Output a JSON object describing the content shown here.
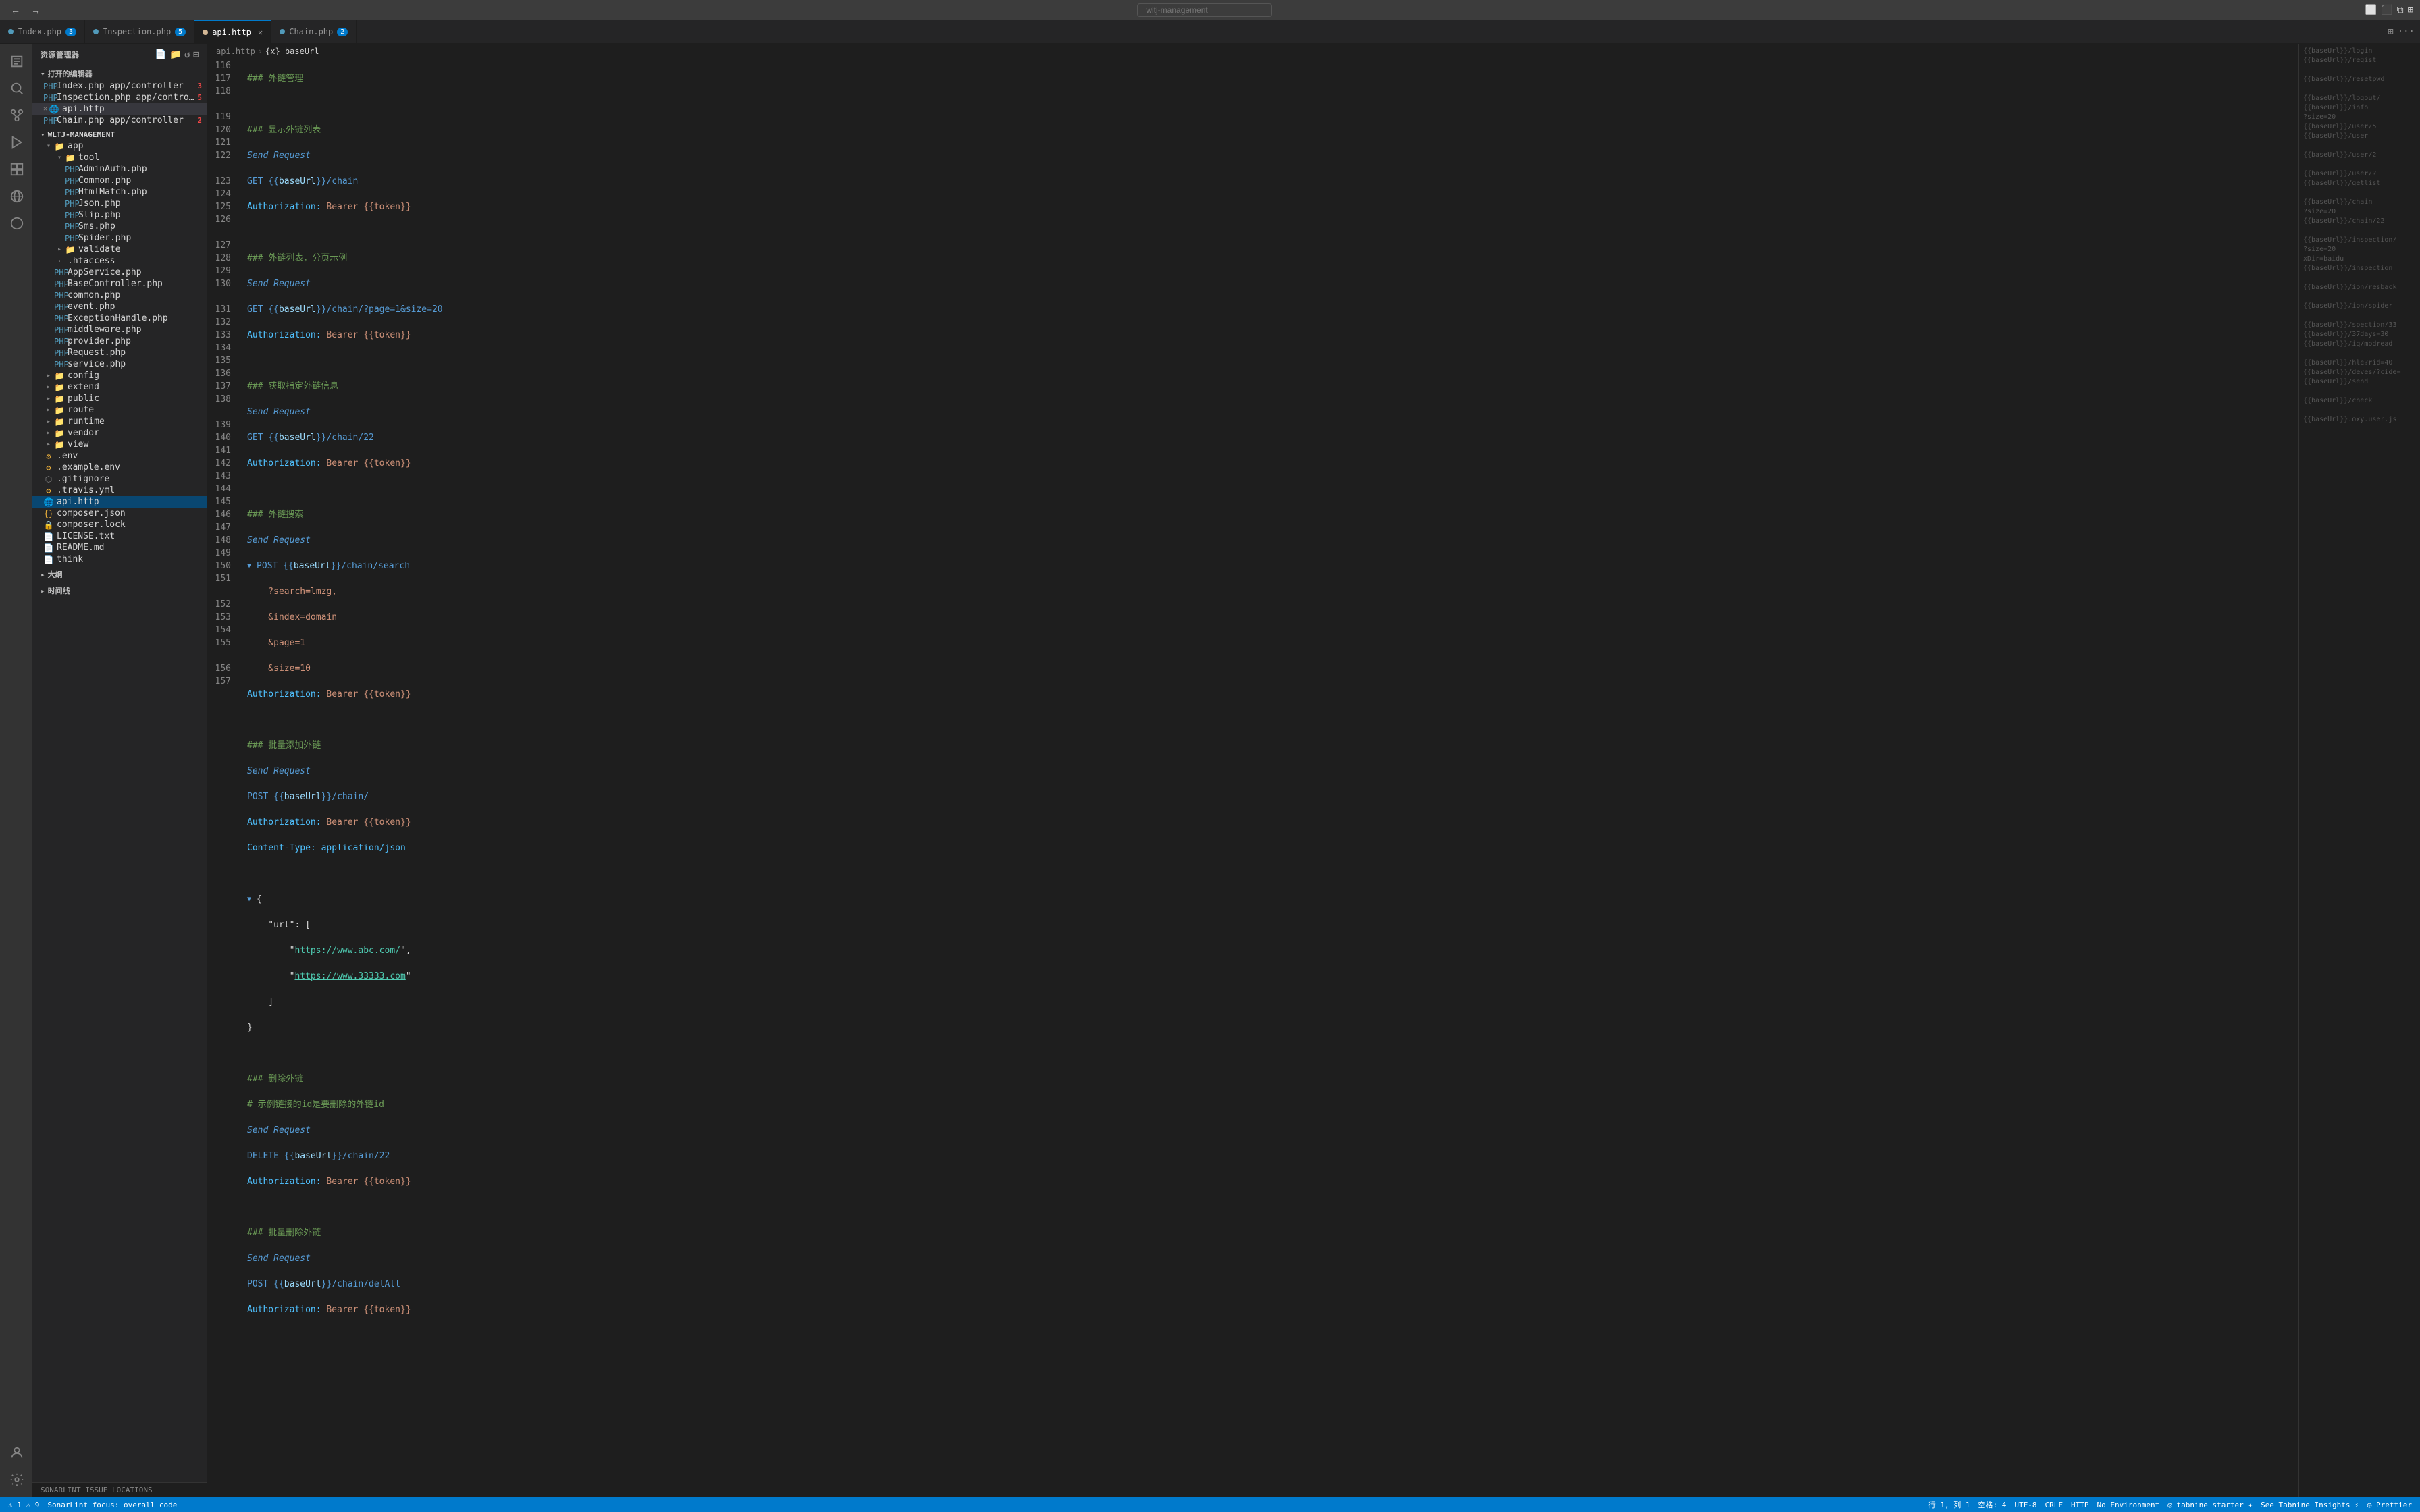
{
  "titleBar": {
    "back": "←",
    "forward": "→",
    "searchPlaceholder": "witj-management",
    "layoutIcons": [
      "⬜",
      "⬛",
      "⧉",
      "⊞"
    ]
  },
  "tabs": [
    {
      "id": "index",
      "icon": "php",
      "iconColor": "#519aba",
      "label": "Index.php",
      "badge": "3",
      "active": false,
      "modified": false
    },
    {
      "id": "inspection",
      "icon": "php",
      "iconColor": "#519aba",
      "label": "Inspection.php",
      "badge": "5",
      "active": false,
      "modified": false
    },
    {
      "id": "api",
      "icon": "http",
      "iconColor": "#d4b896",
      "label": "api.http",
      "active": true,
      "modified": false,
      "close": true
    },
    {
      "id": "chain",
      "icon": "php",
      "iconColor": "#519aba",
      "label": "Chain.php",
      "badge": "2",
      "active": false,
      "modified": false
    }
  ],
  "activityBar": {
    "items": [
      {
        "id": "explorer",
        "icon": "📄",
        "active": false
      },
      {
        "id": "search",
        "icon": "🔍",
        "active": false
      },
      {
        "id": "scm",
        "icon": "⑂",
        "active": false
      },
      {
        "id": "debug",
        "icon": "▶",
        "active": false
      },
      {
        "id": "extensions",
        "icon": "⊞",
        "active": false
      },
      {
        "id": "remote",
        "icon": "☁",
        "active": false
      },
      {
        "id": "accounts",
        "icon": "👤",
        "active": false
      },
      {
        "id": "settings",
        "icon": "⚙",
        "active": false
      }
    ]
  },
  "sidebar": {
    "explorerTitle": "资源管理器",
    "openEditorsTitle": "打开的编辑器",
    "openFiles": [
      {
        "name": "Index.php",
        "path": "app/controller",
        "badge": "3",
        "icon": "php",
        "iconColor": "#519aba"
      },
      {
        "name": "Inspection.php",
        "path": "app/controller",
        "badge": "5",
        "icon": "php",
        "iconColor": "#519aba"
      },
      {
        "name": "api.http",
        "path": "",
        "active": true,
        "close": true,
        "icon": "http",
        "iconColor": "#d4b896"
      },
      {
        "name": "Chain.php",
        "path": "app/controller",
        "badge": "2",
        "icon": "php",
        "iconColor": "#519aba"
      }
    ],
    "projectName": "WLTJ-MANAGEMENT",
    "projectTree": {
      "app": {
        "expanded": true,
        "children": {
          "tool": {
            "expanded": true,
            "files": [
              "AdminAuth.php",
              "Common.php",
              "HtmlMatch.php",
              "Json.php",
              "Slip.php",
              "Sms.php",
              "Spider.php"
            ]
          },
          "validate": {
            "expanded": false
          },
          ".htaccess": null,
          "AppService.php": null,
          "BaseController.php": null,
          "common.php": null,
          "event.php": null,
          "ExceptionHandle.php": null,
          "middleware.php": null,
          "provider.php": null,
          "Request.php": null,
          "service.php": null
        }
      },
      "config": {
        "expanded": false
      },
      "extend": {
        "expanded": false
      },
      "public": {
        "expanded": false
      },
      "route": {
        "expanded": false
      },
      "runtime": {
        "expanded": false
      },
      "vendor": {
        "expanded": false
      },
      "view": {
        "expanded": false
      },
      "dotFiles": [
        {
          "name": ".env",
          "icon": "⚙"
        },
        {
          "name": ".example.env",
          "icon": "⚙"
        },
        {
          "name": ".gitignore",
          "icon": "⬡"
        },
        {
          "name": ".travis.yml",
          "icon": "⚙"
        }
      ],
      "rootFiles": [
        {
          "name": "api.http",
          "active": true
        },
        {
          "name": "composer.json"
        },
        {
          "name": "composer.lock"
        },
        {
          "name": "LICENSE.txt"
        },
        {
          "name": "README.md"
        },
        {
          "name": "think"
        }
      ]
    },
    "outlineSection": "大纲",
    "timelineSection": "时间线"
  },
  "sonarlint": {
    "label": "SONARLINT ISSUE LOCATIONS"
  },
  "breadcrumb": {
    "parts": [
      "api.http",
      "{x} baseUrl"
    ]
  },
  "editor": {
    "lines": [
      {
        "num": 116,
        "content": [
          {
            "t": "### 外链管理",
            "c": "c-comment"
          }
        ]
      },
      {
        "num": 117,
        "content": []
      },
      {
        "num": 118,
        "content": [
          {
            "t": "### 显示外链列表",
            "c": "c-comment"
          }
        ]
      },
      {
        "num": "",
        "content": [
          {
            "t": "Send Request",
            "c": "c-send"
          }
        ]
      },
      {
        "num": 119,
        "content": [
          {
            "t": "GET {{",
            "c": "c-keyword"
          },
          {
            "t": "baseUrl",
            "c": "c-var"
          },
          {
            "t": "}}/chain",
            "c": "c-keyword"
          }
        ]
      },
      {
        "num": 120,
        "content": [
          {
            "t": "Authorization: ",
            "c": "c-header"
          },
          {
            "t": "Bearer {{token}}",
            "c": "c-string"
          }
        ]
      },
      {
        "num": 121,
        "content": []
      },
      {
        "num": 122,
        "content": [
          {
            "t": "### 外链列表，分页示例",
            "c": "c-comment"
          }
        ]
      },
      {
        "num": "",
        "content": [
          {
            "t": "Send Request",
            "c": "c-send"
          }
        ]
      },
      {
        "num": 123,
        "content": [
          {
            "t": "GET {{",
            "c": "c-keyword"
          },
          {
            "t": "baseUrl",
            "c": "c-var"
          },
          {
            "t": "}}/chain/?page=1&size=20",
            "c": "c-keyword"
          }
        ]
      },
      {
        "num": 124,
        "content": [
          {
            "t": "Authorization: ",
            "c": "c-header"
          },
          {
            "t": "Bearer {{token}}",
            "c": "c-string"
          }
        ]
      },
      {
        "num": 125,
        "content": []
      },
      {
        "num": 126,
        "content": [
          {
            "t": "### 获取指定外链信息",
            "c": "c-comment"
          }
        ]
      },
      {
        "num": "",
        "content": [
          {
            "t": "Send Request",
            "c": "c-send"
          }
        ]
      },
      {
        "num": 127,
        "content": [
          {
            "t": "GET {{",
            "c": "c-keyword"
          },
          {
            "t": "baseUrl",
            "c": "c-var"
          },
          {
            "t": "}}/chain/22",
            "c": "c-keyword"
          }
        ]
      },
      {
        "num": 128,
        "content": [
          {
            "t": "Authorization: ",
            "c": "c-header"
          },
          {
            "t": "Bearer {{token}}",
            "c": "c-string"
          }
        ]
      },
      {
        "num": 129,
        "content": []
      },
      {
        "num": 130,
        "content": [
          {
            "t": "### 外链搜索",
            "c": "c-comment"
          }
        ]
      },
      {
        "num": "",
        "content": [
          {
            "t": "Send Request",
            "c": "c-send"
          }
        ]
      },
      {
        "num": 131,
        "content": [
          {
            "t": "▼ ",
            "c": "fold-icon"
          },
          {
            "t": "POST {{",
            "c": "c-keyword"
          },
          {
            "t": "baseUrl",
            "c": "c-var"
          },
          {
            "t": "}}/chain/search",
            "c": "c-keyword"
          }
        ]
      },
      {
        "num": 132,
        "content": [
          {
            "t": "    ?search=lmzg,",
            "c": "c-string"
          }
        ]
      },
      {
        "num": 133,
        "content": [
          {
            "t": "    &index=domain",
            "c": "c-string"
          }
        ]
      },
      {
        "num": 134,
        "content": [
          {
            "t": "    &page=1",
            "c": "c-string"
          }
        ]
      },
      {
        "num": 135,
        "content": [
          {
            "t": "    &size=10",
            "c": "c-string"
          }
        ]
      },
      {
        "num": 136,
        "content": [
          {
            "t": "Authorization: ",
            "c": "c-header"
          },
          {
            "t": "Bearer {{token}}",
            "c": "c-string"
          }
        ]
      },
      {
        "num": 137,
        "content": []
      },
      {
        "num": 138,
        "content": [
          {
            "t": "### 批量添加外链",
            "c": "c-comment"
          }
        ]
      },
      {
        "num": "",
        "content": [
          {
            "t": "Send Request",
            "c": "c-send"
          }
        ]
      },
      {
        "num": 139,
        "content": [
          {
            "t": "POST {{",
            "c": "c-keyword"
          },
          {
            "t": "baseUrl",
            "c": "c-var"
          },
          {
            "t": "}}/chain/",
            "c": "c-keyword"
          }
        ]
      },
      {
        "num": 140,
        "content": [
          {
            "t": "Authorization: ",
            "c": "c-header"
          },
          {
            "t": "Bearer {{token}}",
            "c": "c-string"
          }
        ]
      },
      {
        "num": 141,
        "content": [
          {
            "t": "Content-Type: application/json",
            "c": "c-header"
          }
        ]
      },
      {
        "num": 142,
        "content": []
      },
      {
        "num": 143,
        "content": [
          {
            "t": "▼ {",
            "c": "fold-icon"
          }
        ]
      },
      {
        "num": 144,
        "content": [
          {
            "t": "    \"url\": [",
            "c": "c-punct"
          }
        ]
      },
      {
        "num": 145,
        "content": [
          {
            "t": "        \"",
            "c": "c-punct"
          },
          {
            "t": "https://www.abc.com/",
            "c": "c-url"
          },
          {
            "t": "\",",
            "c": "c-punct"
          }
        ]
      },
      {
        "num": 146,
        "content": [
          {
            "t": "        \"",
            "c": "c-punct"
          },
          {
            "t": "https://www.33333.com",
            "c": "c-url"
          },
          {
            "t": "\"",
            "c": "c-punct"
          }
        ]
      },
      {
        "num": 147,
        "content": [
          {
            "t": "    ]",
            "c": "c-punct"
          }
        ]
      },
      {
        "num": 148,
        "content": [
          {
            "t": "}",
            "c": "c-punct"
          }
        ]
      },
      {
        "num": 149,
        "content": []
      },
      {
        "num": 150,
        "content": [
          {
            "t": "### 删除外链",
            "c": "c-comment"
          }
        ]
      },
      {
        "num": 151,
        "content": [
          {
            "t": "# 示例链接的id是要删除的外链id",
            "c": "c-comment"
          }
        ]
      },
      {
        "num": "",
        "content": [
          {
            "t": "Send Request",
            "c": "c-send"
          }
        ]
      },
      {
        "num": 152,
        "content": [
          {
            "t": "DELETE {{",
            "c": "c-keyword"
          },
          {
            "t": "baseUrl",
            "c": "c-var"
          },
          {
            "t": "}}/chain/22",
            "c": "c-keyword"
          }
        ]
      },
      {
        "num": 153,
        "content": [
          {
            "t": "Authorization: ",
            "c": "c-header"
          },
          {
            "t": "Bearer {{token}}",
            "c": "c-string"
          }
        ]
      },
      {
        "num": 154,
        "content": []
      },
      {
        "num": 155,
        "content": [
          {
            "t": "### 批量删除外链",
            "c": "c-comment"
          }
        ]
      },
      {
        "num": "",
        "content": [
          {
            "t": "Send Request",
            "c": "c-send"
          }
        ]
      },
      {
        "num": 156,
        "content": [
          {
            "t": "POST {{",
            "c": "c-keyword"
          },
          {
            "t": "baseUrl",
            "c": "c-var"
          },
          {
            "t": "}}/chain/delAll",
            "c": "c-keyword"
          }
        ]
      },
      {
        "num": 157,
        "content": [
          {
            "t": "Authorization: ",
            "c": "c-header"
          },
          {
            "t": "Bearer {{token}}",
            "c": "c-string"
          }
        ]
      }
    ]
  },
  "rightPanel": {
    "items": [
      "{{baseUrl}}/login",
      "{{baseUrl}}/regist",
      "",
      "{{baseUrl}}/resetpwd",
      "",
      "{{baseUrl}}/logout/",
      "{{baseUrl}}/info",
      "?size=20",
      "{{baseUrl}}/user/5",
      "{{baseUrl}}/user",
      "",
      "{{baseUrl}}/user/2",
      "",
      "{{baseUrl}}/user/?",
      "{{baseUrl}}/getlist",
      "",
      "{{baseUrl}}/chain",
      "?size=20",
      "{{baseUrl}}/chain/22",
      "",
      "{{baseUrl}}/inspection/",
      "?size=20",
      "xDir=baidu",
      "{{baseUrl}}/inspection",
      "",
      "{{baseUrl}}/ion/resback",
      "",
      "{{baseUrl}}/ion/spider",
      "",
      "{{baseUrl}}/spection/33",
      "{{baseUrl}}/37days=30",
      "{{baseUrl}}/iq/modread",
      "",
      "{{baseUrl}}/hle?rid=40",
      "{{baseUrl}}/deves/?cide=",
      "{{baseUrl}}/send",
      "",
      "{{baseUrl}}/check",
      "",
      "{{baseUrl}}.oxy.user.js"
    ]
  },
  "statusBar": {
    "errors": "⚠ 1",
    "warnings": "⚠ 9",
    "sonarStatus": "SonarLint focus: overall code",
    "position": "行 1, 列 1",
    "spaces": "空格: 4",
    "encoding": "UTF-8",
    "lineEnding": "CRLF",
    "language": "HTTP",
    "environment": "No Environment",
    "tabnine": "◎ tabnine starter ✦",
    "tabnineInsights": "See Tabnine Insights ⚡",
    "prettier": "◎ Prettier"
  }
}
